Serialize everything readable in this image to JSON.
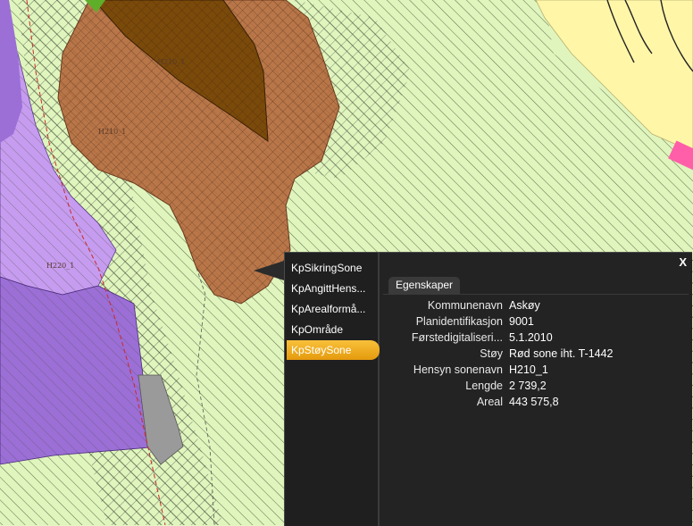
{
  "map": {
    "labels": {
      "zone_a": "H210_1",
      "zone_b": "H210_1",
      "zone_c": "H220_1"
    }
  },
  "popup": {
    "close_label": "X",
    "layers": [
      {
        "label": "KpSikringSone",
        "active": false
      },
      {
        "label": "KpAngittHens...",
        "active": false
      },
      {
        "label": "KpArealformå...",
        "active": false
      },
      {
        "label": "KpOmråde",
        "active": false
      },
      {
        "label": "KpStøySone",
        "active": true
      }
    ],
    "tab_label": "Egenskaper",
    "properties": [
      {
        "key": "Kommunenavn",
        "value": "Askøy"
      },
      {
        "key": "Planidentifikasjon",
        "value": "9001"
      },
      {
        "key": "Førstedigitaliseri...",
        "value": "5.1.2010"
      },
      {
        "key": "Støy",
        "value": "Rød sone iht. T-1442"
      },
      {
        "key": "Hensyn sonenavn",
        "value": "H210_1"
      },
      {
        "key": "Lengde",
        "value": "2 739,2"
      },
      {
        "key": "Areal",
        "value": "443 575,8"
      }
    ],
    "colors": {
      "active_layer": "#f2a81d",
      "background": "#232323"
    }
  }
}
